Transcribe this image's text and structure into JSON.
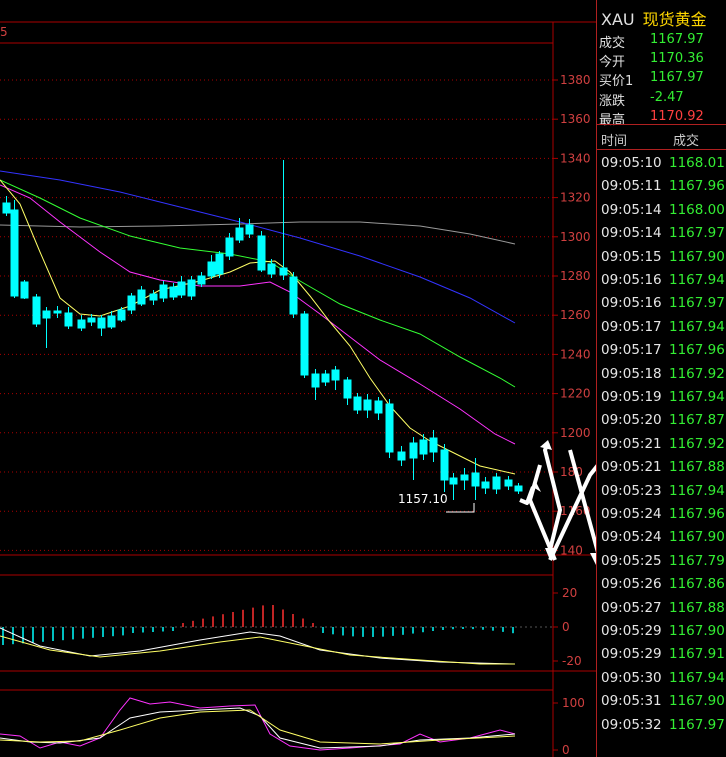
{
  "header": {
    "symbol": "XAU",
    "name": "现货黄金",
    "partial_label": "5"
  },
  "quote": [
    {
      "label": "成交",
      "value": "1167.97",
      "color": "#33ee33"
    },
    {
      "label": "今开",
      "value": "1170.36",
      "color": "#33ee33"
    },
    {
      "label": "买价1",
      "value": "1167.97",
      "color": "#33ee33"
    },
    {
      "label": "涨跌",
      "value": "-2.47",
      "color": "#33ee33"
    },
    {
      "label": "最高",
      "value": "1170.92",
      "color": "#ff4040"
    }
  ],
  "ticks_header": {
    "time": "时间",
    "price": "成交"
  },
  "ticks": [
    {
      "time": "09:05:10",
      "price": "1168.01",
      "color": "#33ee33"
    },
    {
      "time": "09:05:11",
      "price": "1167.96",
      "color": "#33ee33"
    },
    {
      "time": "09:05:14",
      "price": "1168.00",
      "color": "#33ee33"
    },
    {
      "time": "09:05:14",
      "price": "1167.97",
      "color": "#33ee33"
    },
    {
      "time": "09:05:15",
      "price": "1167.90",
      "color": "#33ee33"
    },
    {
      "time": "09:05:16",
      "price": "1167.94",
      "color": "#33ee33"
    },
    {
      "time": "09:05:16",
      "price": "1167.97",
      "color": "#33ee33"
    },
    {
      "time": "09:05:17",
      "price": "1167.94",
      "color": "#33ee33"
    },
    {
      "time": "09:05:17",
      "price": "1167.96",
      "color": "#33ee33"
    },
    {
      "time": "09:05:18",
      "price": "1167.92",
      "color": "#33ee33"
    },
    {
      "time": "09:05:19",
      "price": "1167.94",
      "color": "#33ee33"
    },
    {
      "time": "09:05:20",
      "price": "1167.87",
      "color": "#33ee33"
    },
    {
      "time": "09:05:21",
      "price": "1167.92",
      "color": "#33ee33"
    },
    {
      "time": "09:05:21",
      "price": "1167.88",
      "color": "#33ee33"
    },
    {
      "time": "09:05:23",
      "price": "1167.94",
      "color": "#33ee33"
    },
    {
      "time": "09:05:24",
      "price": "1167.96",
      "color": "#33ee33"
    },
    {
      "time": "09:05:24",
      "price": "1167.90",
      "color": "#33ee33"
    },
    {
      "time": "09:05:25",
      "price": "1167.79",
      "color": "#33ee33"
    },
    {
      "time": "09:05:26",
      "price": "1167.86",
      "color": "#33ee33"
    },
    {
      "time": "09:05:27",
      "price": "1167.88",
      "color": "#33ee33"
    },
    {
      "time": "09:05:29",
      "price": "1167.90",
      "color": "#33ee33"
    },
    {
      "time": "09:05:29",
      "price": "1167.91",
      "color": "#33ee33"
    },
    {
      "time": "09:05:30",
      "price": "1167.94",
      "color": "#33ee33"
    },
    {
      "time": "09:05:31",
      "price": "1167.90",
      "color": "#33ee33"
    },
    {
      "time": "09:05:32",
      "price": "1167.97",
      "color": "#33ee33"
    }
  ],
  "chart": {
    "price_axis": [
      "1380",
      "1360",
      "1340",
      "1320",
      "1300",
      "1280",
      "1260",
      "1240",
      "1220",
      "1200",
      "180",
      "1160",
      "140"
    ],
    "low_annotation": "1157.10",
    "macd_axis": [
      "20",
      "0",
      "-20"
    ],
    "osc_axis": [
      "100",
      "0"
    ],
    "colors": {
      "up": "#ff3030",
      "down": "#00ffff",
      "ma_yellow": "#ffff66",
      "ma_green": "#33ff33",
      "ma_magenta": "#ff33ff",
      "ma_blue": "#3333ff",
      "ma_gray": "#999999",
      "grid": "#aa0000"
    }
  }
}
